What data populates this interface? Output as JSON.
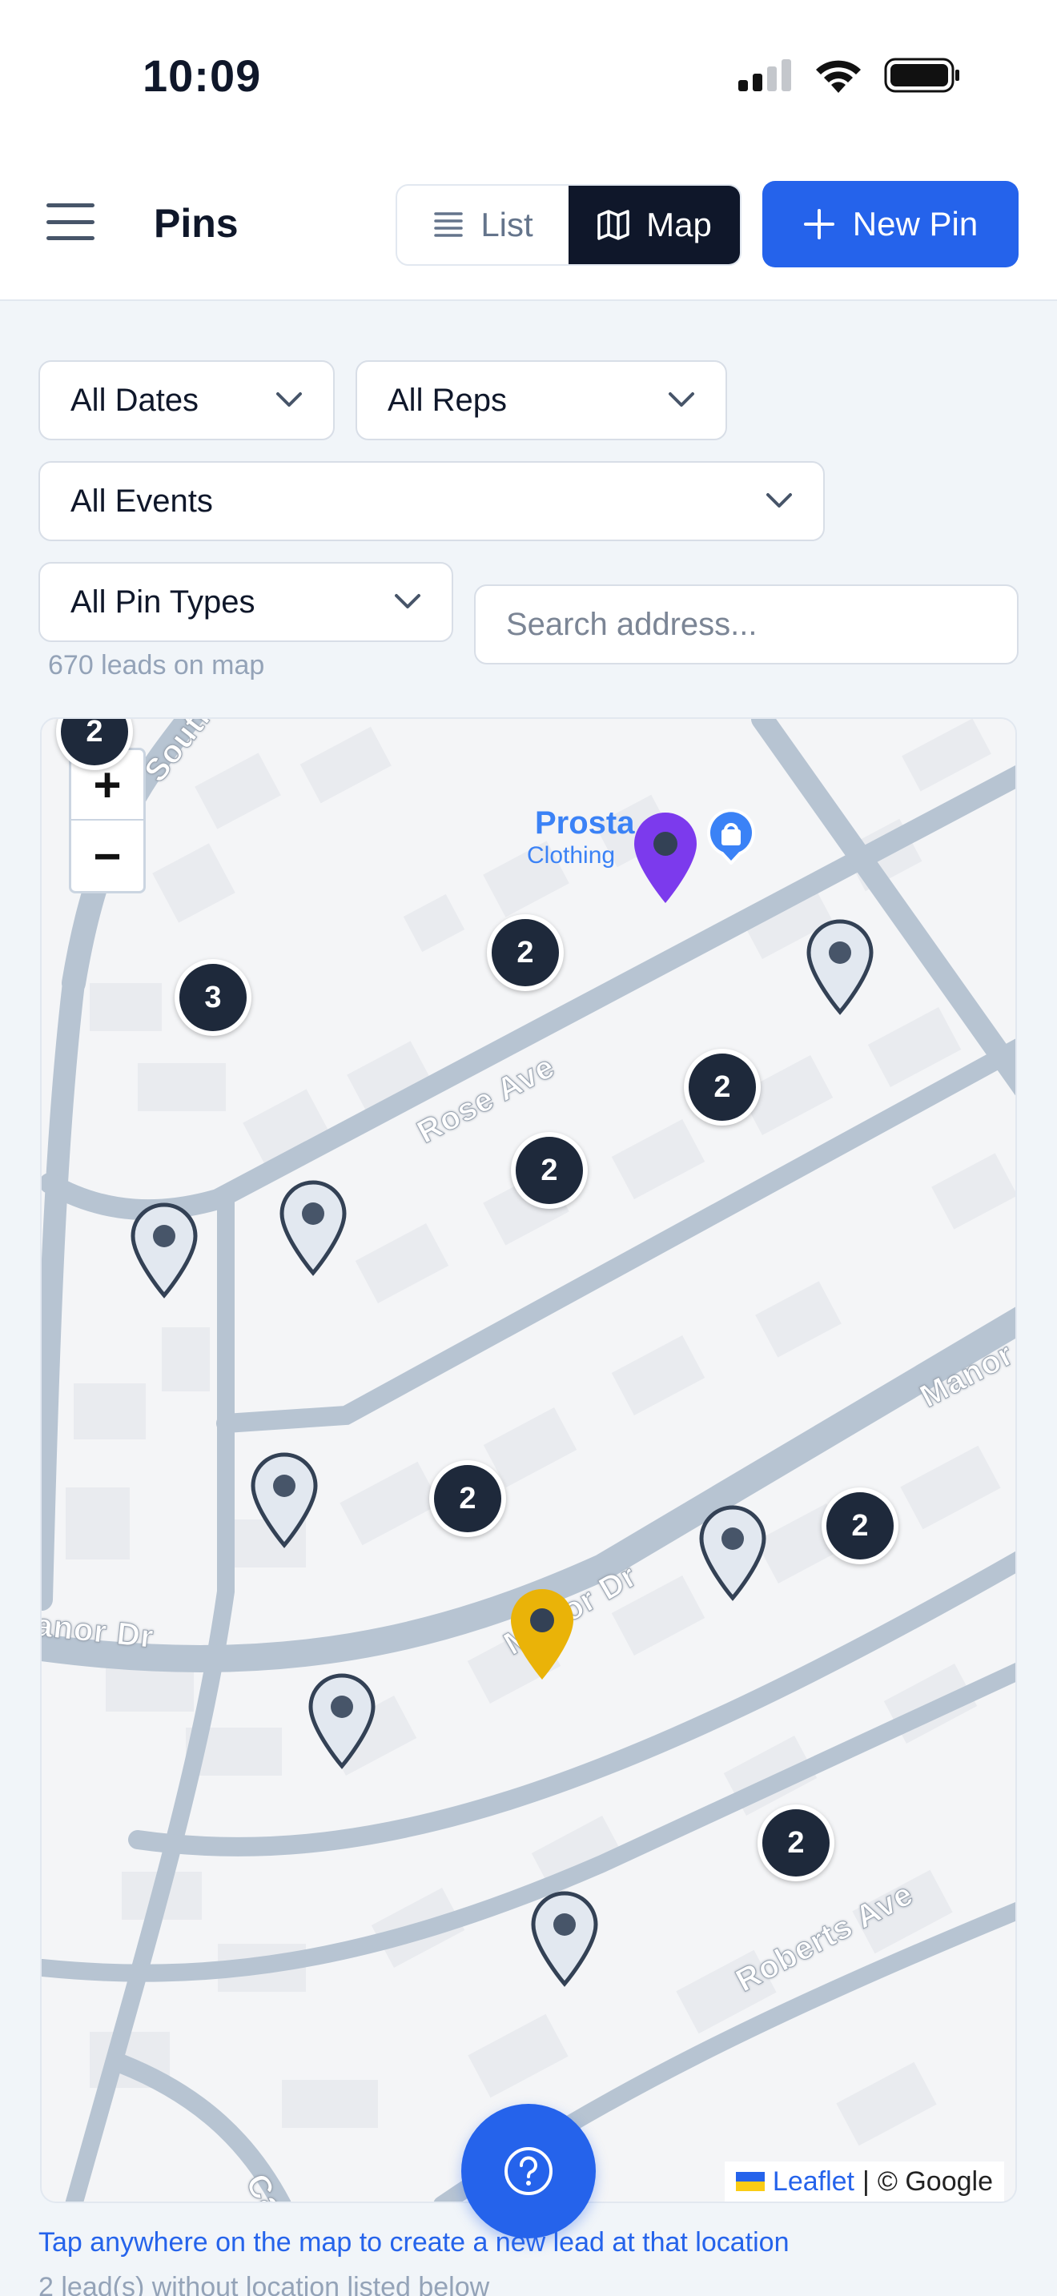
{
  "status_bar": {
    "time": "10:09"
  },
  "header": {
    "title": "Pins",
    "view_toggle": {
      "list_label": "List",
      "map_label": "Map",
      "active": "Map"
    },
    "new_pin_label": "New Pin"
  },
  "filters": {
    "dates": "All Dates",
    "reps": "All Reps",
    "events": "All Events",
    "pin_types": "All Pin Types",
    "search_placeholder": "Search address...",
    "leads_count": "670 leads on map"
  },
  "map": {
    "zoom_in": "+",
    "zoom_out": "−",
    "roads": [
      "Southern",
      "Rose Ave",
      "Manor",
      "Manor Dr",
      "anor Dr",
      "Roberts Ave",
      "Ca"
    ],
    "poi": {
      "name": "Prosta",
      "category": "Clothing"
    },
    "clusters": [
      "2",
      "3",
      "2",
      "2",
      "2",
      "2",
      "2",
      "2"
    ],
    "attribution": {
      "leaflet": "Leaflet",
      "separator": "|",
      "provider": "© Google"
    },
    "pin_colors": {
      "default": "#e2e8f0",
      "purple": "#7c3aed",
      "yellow": "#eab308"
    }
  },
  "footer": {
    "hint": "Tap anywhere on the map to create a new lead at that location",
    "no_location": "2 lead(s) without location listed below"
  }
}
